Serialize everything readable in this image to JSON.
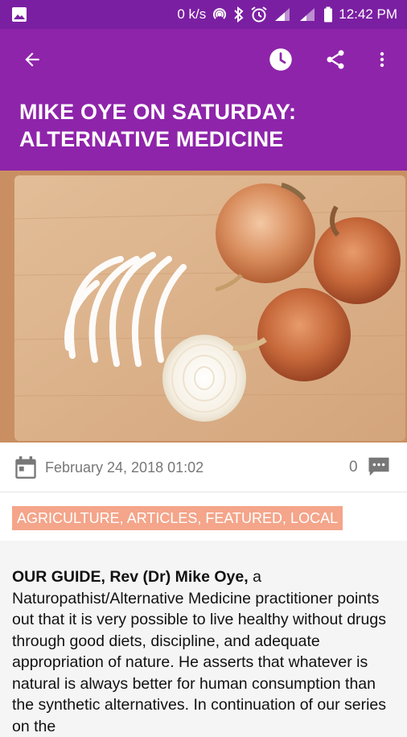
{
  "status": {
    "speed": "0 k/s",
    "time": "12:42 PM"
  },
  "toolbar": {
    "title": "MIKE OYE ON SATURDAY: ALTERNATIVE MEDICINE"
  },
  "hero": {
    "description": "Onions on a wooden cutting board"
  },
  "meta": {
    "date": "February 24, 2018 01:02",
    "comment_count": "0"
  },
  "tags": "AGRICULTURE, ARTICLES, FEATURED, LOCAL",
  "article": {
    "lead": "OUR GUIDE, Rev (Dr) Mike Oye,",
    "body": " a Naturopathist/Alternative Medicine practitioner points out that it is very possible to live healthy without drugs through good diets, discipline, and adequate appropriation of nature. He asserts that whatever is natural is always better for human consumption than the synthetic alternatives. In continuation of our series on the"
  },
  "colors": {
    "primary": "#8e24aa",
    "primary_dark": "#7b1fa2",
    "tag_bg": "#f4a58a"
  }
}
